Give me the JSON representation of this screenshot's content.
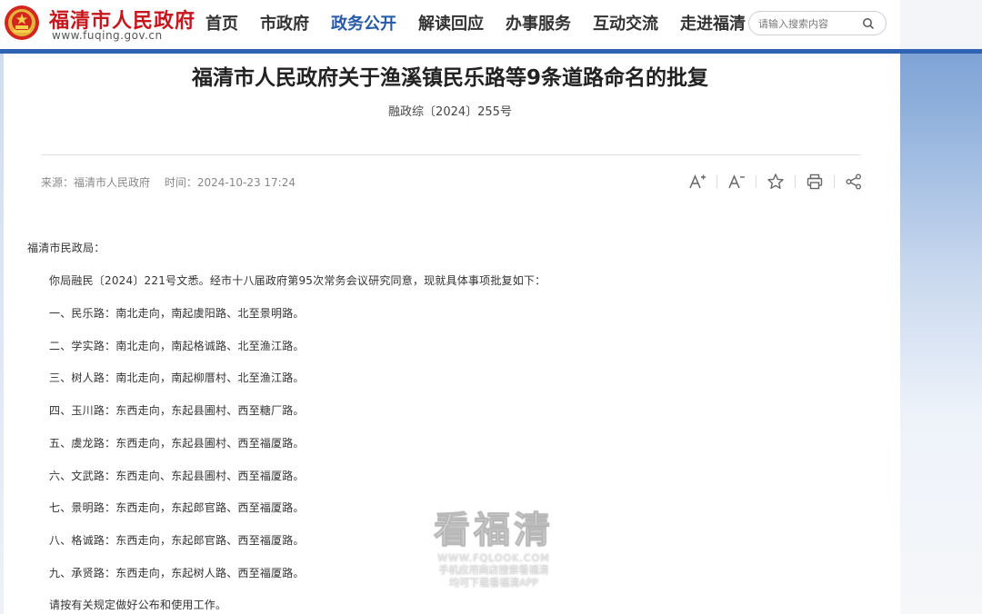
{
  "header": {
    "site_name": "福清市人民政府",
    "site_url": "www.fuqing.gov.cn",
    "nav": [
      "首页",
      "市政府",
      "政务公开",
      "解读回应",
      "办事服务",
      "互动交流",
      "走进福清"
    ],
    "active_nav": "政务公开",
    "search_placeholder": "请输入搜索内容",
    "brand_color": "#c8161d",
    "accent_color": "#2e63b4"
  },
  "article": {
    "title": "福清市人民政府关于渔溪镇民乐路等9条道路命名的批复",
    "doc_number": "融政综〔2024〕255号",
    "source_label": "来源：福清市人民政府",
    "time_label": "时间：2024-10-23 17:24",
    "tools": [
      "font-increase-icon",
      "font-decrease-icon",
      "star-icon",
      "print-icon",
      "share-icon"
    ],
    "salutation": "福清市民政局：",
    "paragraphs": [
      "你局融民〔2024〕221号文悉。经市十八届政府第95次常务会议研究同意，现就具体事项批复如下：",
      "一、民乐路：南北走向，南起虞阳路、北至景明路。",
      "二、学实路：南北走向，南起格诚路、北至渔江路。",
      "三、树人路：南北走向，南起柳厝村、北至渔江路。",
      "四、玉川路：东西走向，东起县圃村、西至糖厂路。",
      "五、虞龙路：东西走向，东起县圃村、西至福厦路。",
      "六、文武路：东西走向、东起县圃村、西至福厦路。",
      "七、景明路：东西走向，东起郎官路、西至福厦路。",
      "八、格诚路：东西走向，东起郎官路、西至福厦路。",
      "九、承贤路：东西走向，东起树人路、西至福厦路。",
      "请按有关规定做好公布和使用工作。"
    ]
  },
  "watermark": {
    "brand": "看福清",
    "url": "WWW.FQLOOK.COM",
    "line1": "手机应用商店搜索看福清",
    "line2": "均可下载看福清APP"
  }
}
